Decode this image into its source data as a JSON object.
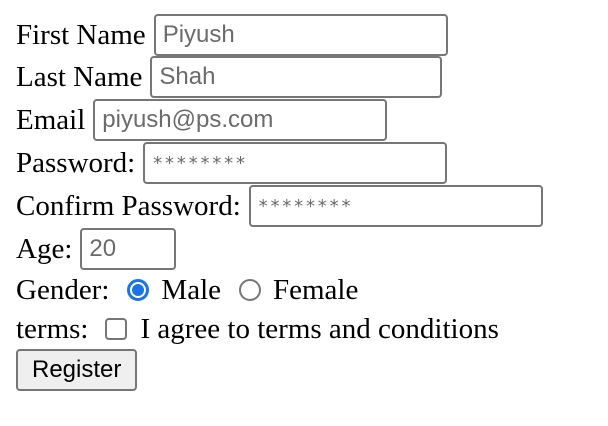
{
  "form": {
    "first_name": {
      "label": "First Name",
      "value": "Piyush"
    },
    "last_name": {
      "label": "Last Name",
      "value": "Shah"
    },
    "email": {
      "label": "Email",
      "value": "piyush@ps.com"
    },
    "password": {
      "label": "Password:",
      "value": "********"
    },
    "confirm_password": {
      "label": "Confirm Password:",
      "value": "********"
    },
    "age": {
      "label": "Age:",
      "value": "20"
    },
    "gender": {
      "label": "Gender:",
      "options": [
        {
          "label": "Male",
          "selected": true
        },
        {
          "label": "Female",
          "selected": false
        }
      ]
    },
    "terms": {
      "label": "terms:",
      "checkbox_label": "I agree to terms and conditions",
      "checked": false
    },
    "submit": {
      "label": "Register"
    }
  },
  "colors": {
    "accent": "#1a73e8",
    "border": "#767676",
    "button_bg": "#efefef"
  }
}
